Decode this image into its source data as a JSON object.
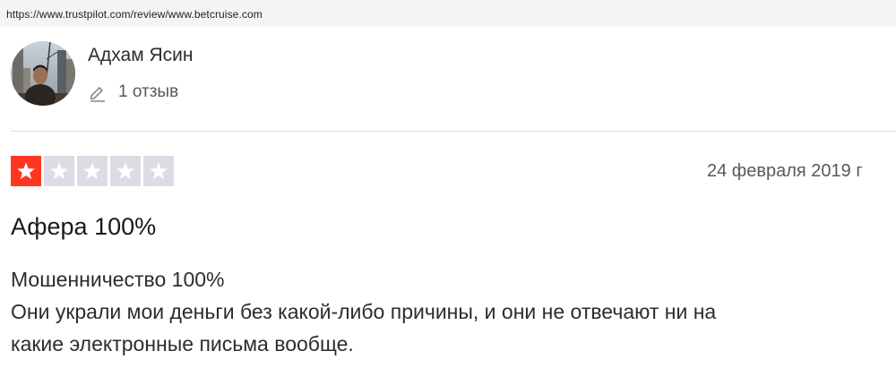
{
  "browser": {
    "url": "https://www.trustpilot.com/review/www.betcruise.com"
  },
  "author": {
    "name": "Адхам Ясин",
    "review_count": "1 отзыв",
    "avatar": "user-photo"
  },
  "review": {
    "rating": 1,
    "rating_max": 5,
    "date": "24 февраля 2019 г",
    "title": "Афера 100%",
    "body_lines": [
      "Мошенничество 100%",
      "Они украли мои деньги без какой-либо причины, и они не отвечают ни на",
      "какие электронные письма вообще."
    ]
  },
  "colors": {
    "star_active": "#ff3722",
    "star_inactive": "#dcdce6",
    "divider": "#dcdce6",
    "url_bar_bg": "#f4f4f4"
  },
  "icons": {
    "star": "star-icon",
    "edit": "pencil-icon"
  }
}
